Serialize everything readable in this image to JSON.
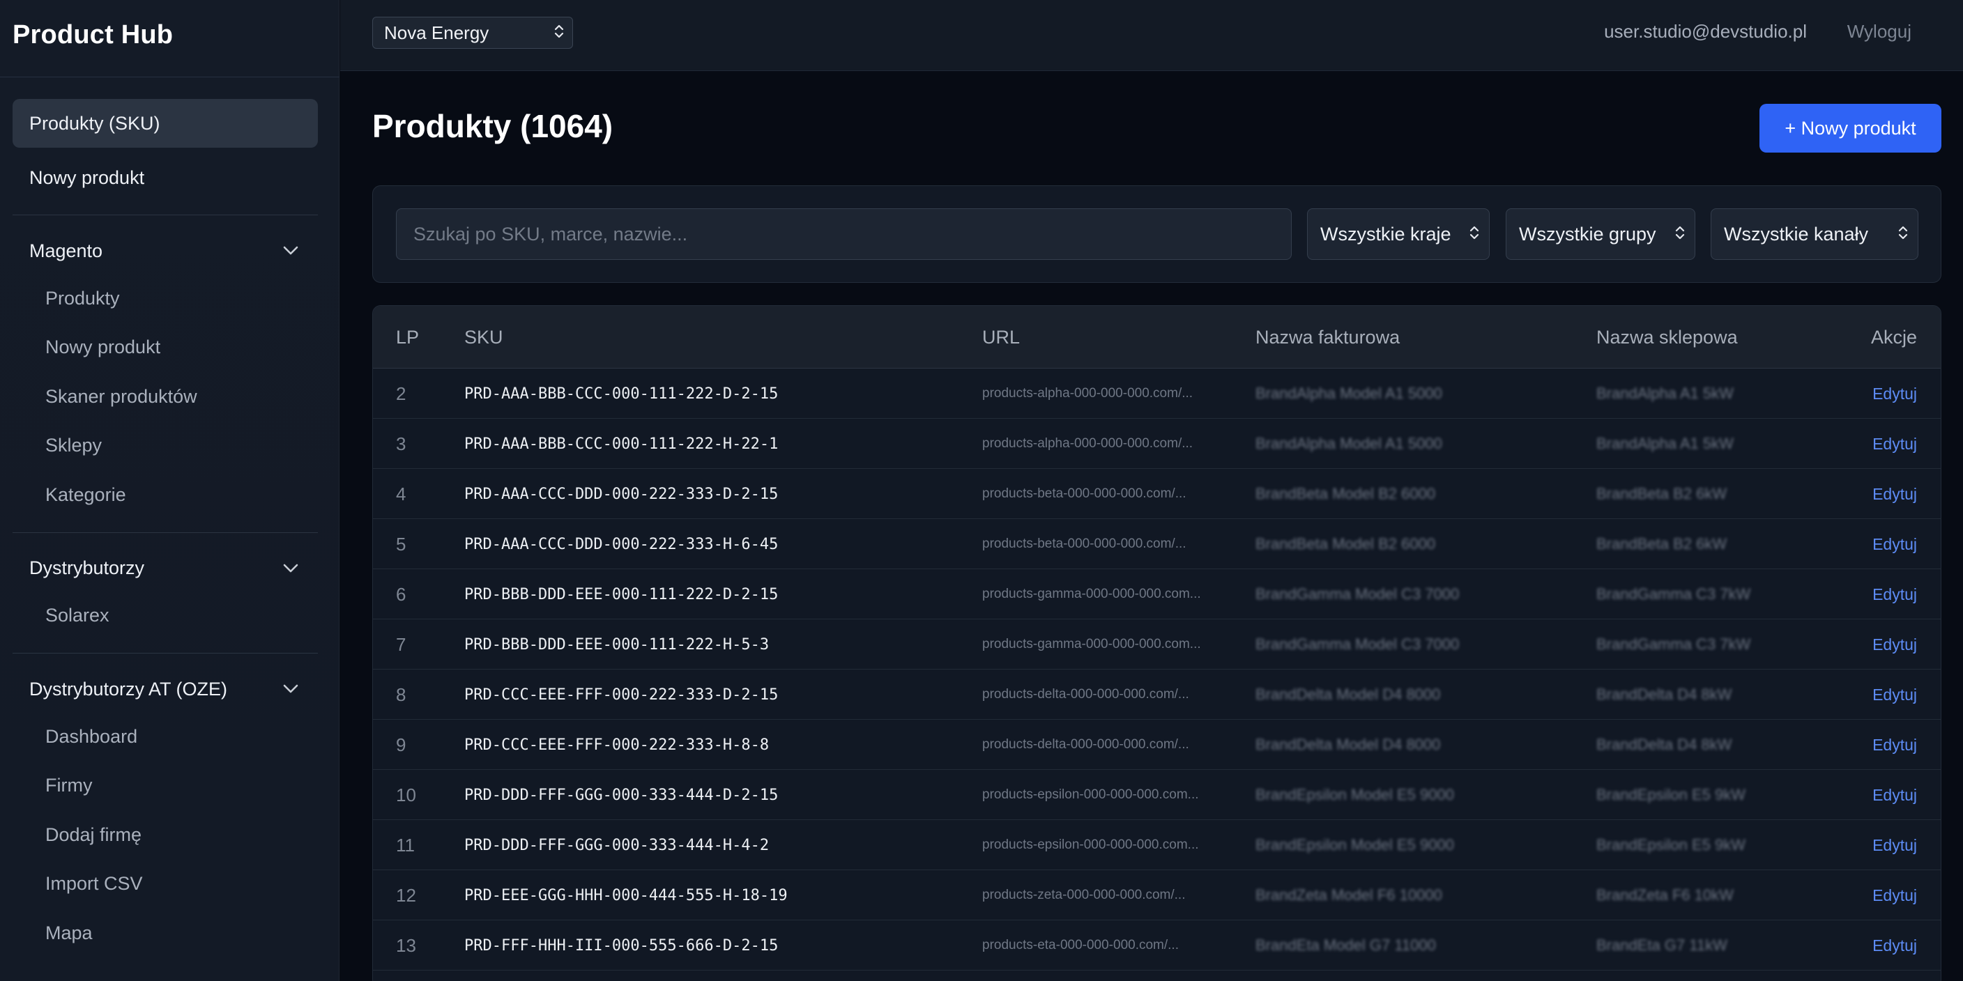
{
  "app": {
    "title": "Product Hub"
  },
  "sidebar": {
    "items": [
      {
        "label": "Produkty (SKU)",
        "active": true
      },
      {
        "label": "Nowy produkt",
        "active": false
      }
    ],
    "sections": [
      {
        "title": "Magento",
        "items": [
          "Produkty",
          "Nowy produkt",
          "Skaner produktów",
          "Sklepy",
          "Kategorie"
        ]
      },
      {
        "title": "Dystrybutorzy",
        "items": [
          "Solarex"
        ]
      },
      {
        "title": "Dystrybutorzy AT (OZE)",
        "items": [
          "Dashboard",
          "Firmy",
          "Dodaj firmę",
          "Import CSV",
          "Mapa"
        ]
      }
    ]
  },
  "topbar": {
    "company": "Nova Energy",
    "user_email": "user.studio@devstudio.pl",
    "logout_label": "Wyloguj"
  },
  "main": {
    "title": "Produkty (1064)",
    "new_button": "+ Nowy produkt",
    "search_placeholder": "Szukaj po SKU, marce, nazwie...",
    "filters": {
      "countries": "Wszystkie kraje",
      "groups": "Wszystkie grupy",
      "channels": "Wszystkie kanały"
    }
  },
  "table": {
    "columns": {
      "lp": "LP",
      "sku": "SKU",
      "url": "URL",
      "invoice_name": "Nazwa fakturowa",
      "shop_name": "Nazwa sklepowa",
      "actions": "Akcje"
    },
    "action_label": "Edytuj",
    "rows": [
      {
        "lp": "2",
        "sku": "PRD-AAA-BBB-CCC-000-111-222-D-2-15",
        "url": "products-alpha-000-000-000.com/...",
        "invoice_name": "BrandAlpha Model A1 5000",
        "shop_name": "BrandAlpha A1 5kW"
      },
      {
        "lp": "3",
        "sku": "PRD-AAA-BBB-CCC-000-111-222-H-22-1",
        "url": "products-alpha-000-000-000.com/...",
        "invoice_name": "BrandAlpha Model A1 5000",
        "shop_name": "BrandAlpha A1 5kW"
      },
      {
        "lp": "4",
        "sku": "PRD-AAA-CCC-DDD-000-222-333-D-2-15",
        "url": "products-beta-000-000-000.com/...",
        "invoice_name": "BrandBeta Model B2 6000",
        "shop_name": "BrandBeta B2 6kW"
      },
      {
        "lp": "5",
        "sku": "PRD-AAA-CCC-DDD-000-222-333-H-6-45",
        "url": "products-beta-000-000-000.com/...",
        "invoice_name": "BrandBeta Model B2 6000",
        "shop_name": "BrandBeta B2 6kW"
      },
      {
        "lp": "6",
        "sku": "PRD-BBB-DDD-EEE-000-111-222-D-2-15",
        "url": "products-gamma-000-000-000.com...",
        "invoice_name": "BrandGamma Model C3 7000",
        "shop_name": "BrandGamma C3 7kW"
      },
      {
        "lp": "7",
        "sku": "PRD-BBB-DDD-EEE-000-111-222-H-5-3",
        "url": "products-gamma-000-000-000.com...",
        "invoice_name": "BrandGamma Model C3 7000",
        "shop_name": "BrandGamma C3 7kW"
      },
      {
        "lp": "8",
        "sku": "PRD-CCC-EEE-FFF-000-222-333-D-2-15",
        "url": "products-delta-000-000-000.com/...",
        "invoice_name": "BrandDelta Model D4 8000",
        "shop_name": "BrandDelta D4 8kW"
      },
      {
        "lp": "9",
        "sku": "PRD-CCC-EEE-FFF-000-222-333-H-8-8",
        "url": "products-delta-000-000-000.com/...",
        "invoice_name": "BrandDelta Model D4 8000",
        "shop_name": "BrandDelta D4 8kW"
      },
      {
        "lp": "10",
        "sku": "PRD-DDD-FFF-GGG-000-333-444-D-2-15",
        "url": "products-epsilon-000-000-000.com...",
        "invoice_name": "BrandEpsilon Model E5 9000",
        "shop_name": "BrandEpsilon E5 9kW"
      },
      {
        "lp": "11",
        "sku": "PRD-DDD-FFF-GGG-000-333-444-H-4-2",
        "url": "products-epsilon-000-000-000.com...",
        "invoice_name": "BrandEpsilon Model E5 9000",
        "shop_name": "BrandEpsilon E5 9kW"
      },
      {
        "lp": "12",
        "sku": "PRD-EEE-GGG-HHH-000-444-555-H-18-19",
        "url": "products-zeta-000-000-000.com/...",
        "invoice_name": "BrandZeta Model F6 10000",
        "shop_name": "BrandZeta F6 10kW"
      },
      {
        "lp": "13",
        "sku": "PRD-FFF-HHH-III-000-555-666-D-2-15",
        "url": "products-eta-000-000-000.com/...",
        "invoice_name": "BrandEta Model G7 11000",
        "shop_name": "BrandEta G7 11kW"
      }
    ]
  },
  "colors": {
    "accent": "#2f63f5",
    "link": "#5d8cf5",
    "background": "#070b14",
    "sidebar": "#141b27"
  },
  "icons": {
    "select": "chevron-updown-icon",
    "section_toggle": "chevron-down-icon"
  }
}
